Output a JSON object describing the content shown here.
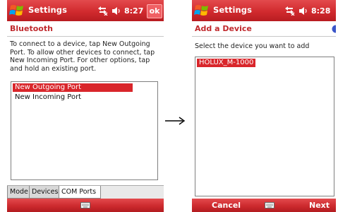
{
  "screen1": {
    "titlebar": {
      "title": "Settings",
      "time": "8:27",
      "ok_label": "ok"
    },
    "header": {
      "title": "Bluetooth"
    },
    "description": "To connect to a device, tap New Outgoing Port. To allow other devices to connect, tap New Incoming Port. For other options, tap and hold an existing port.",
    "ports": [
      {
        "label": "New Outgoing Port",
        "selected": true
      },
      {
        "label": "New Incoming Port",
        "selected": false
      }
    ],
    "tabs": [
      {
        "label": "Mode"
      },
      {
        "label": "Devices"
      },
      {
        "label": "COM Ports",
        "active": true
      }
    ]
  },
  "screen2": {
    "titlebar": {
      "title": "Settings",
      "time": "8:28"
    },
    "header": {
      "title": "Add a Device"
    },
    "instruction": "Select the device you want to add",
    "devices": [
      {
        "label": "HOLUX_M-1000",
        "selected": true
      }
    ],
    "softkeys": {
      "left": "Cancel",
      "right": "Next"
    }
  },
  "colors": {
    "titlebar_red": "#d12a2e",
    "header_red": "#c0282c",
    "selection_red": "#d9262b"
  },
  "icons": [
    "windows-start-icon",
    "connectivity-icon",
    "volume-icon",
    "keyboard-icon",
    "right-arrow-icon",
    "help-icon"
  ]
}
